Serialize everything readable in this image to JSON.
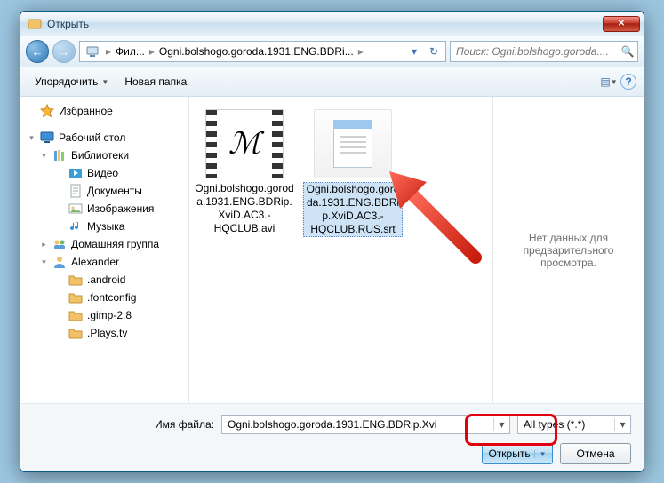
{
  "window": {
    "title": "Открыть"
  },
  "nav": {
    "crumbs": [
      "Фил...",
      "Ogni.bolshogo.goroda.1931.ENG.BDRi..."
    ],
    "search_placeholder": "Поиск: Ogni.bolshogo.goroda...."
  },
  "toolbar": {
    "organize": "Упорядочить",
    "newfolder": "Новая папка"
  },
  "sidebar": {
    "items": [
      {
        "label": "Избранное",
        "icon": "star",
        "lvl": 0,
        "exp": ""
      },
      {
        "label": "",
        "icon": "",
        "lvl": 0,
        "spacer": true
      },
      {
        "label": "Рабочий стол",
        "icon": "desktop",
        "lvl": 0,
        "exp": "▾"
      },
      {
        "label": "Библиотеки",
        "icon": "library",
        "lvl": 1,
        "exp": "▾"
      },
      {
        "label": "Видео",
        "icon": "video",
        "lvl": 2
      },
      {
        "label": "Документы",
        "icon": "doc",
        "lvl": 2
      },
      {
        "label": "Изображения",
        "icon": "pic",
        "lvl": 2
      },
      {
        "label": "Музыка",
        "icon": "music",
        "lvl": 2
      },
      {
        "label": "Домашняя группа",
        "icon": "home",
        "lvl": 1,
        "exp": "▸"
      },
      {
        "label": "Alexander",
        "icon": "user",
        "lvl": 1,
        "exp": "▾"
      },
      {
        "label": ".android",
        "icon": "folder",
        "lvl": 2
      },
      {
        "label": ".fontconfig",
        "icon": "folder",
        "lvl": 2
      },
      {
        "label": ".gimp-2.8",
        "icon": "folder",
        "lvl": 2
      },
      {
        "label": ".Plays.tv",
        "icon": "folder",
        "lvl": 2
      }
    ]
  },
  "files": [
    {
      "name": "Ogni.bolshogo.goroda.1931.ENG.BDRip.XviD.AC3.-HQCLUB.avi",
      "type": "video",
      "selected": false
    },
    {
      "name": "Ogni.bolshogo.goroda.1931.ENG.BDRip.XviD.AC3.-HQCLUB.RUS.srt",
      "type": "text",
      "selected": true
    }
  ],
  "preview": {
    "empty": "Нет данных для предварительного просмотра."
  },
  "footer": {
    "filelabel": "Имя файла:",
    "filename": "Ogni.bolshogo.goroda.1931.ENG.BDRip.Xvi",
    "filter": "All types (*.*)",
    "open": "Открыть",
    "cancel": "Отмена"
  },
  "icons": {
    "star_color": "#f6b73c",
    "desktop_color": "#3e8fd8",
    "folder_color": "#f2c268"
  }
}
